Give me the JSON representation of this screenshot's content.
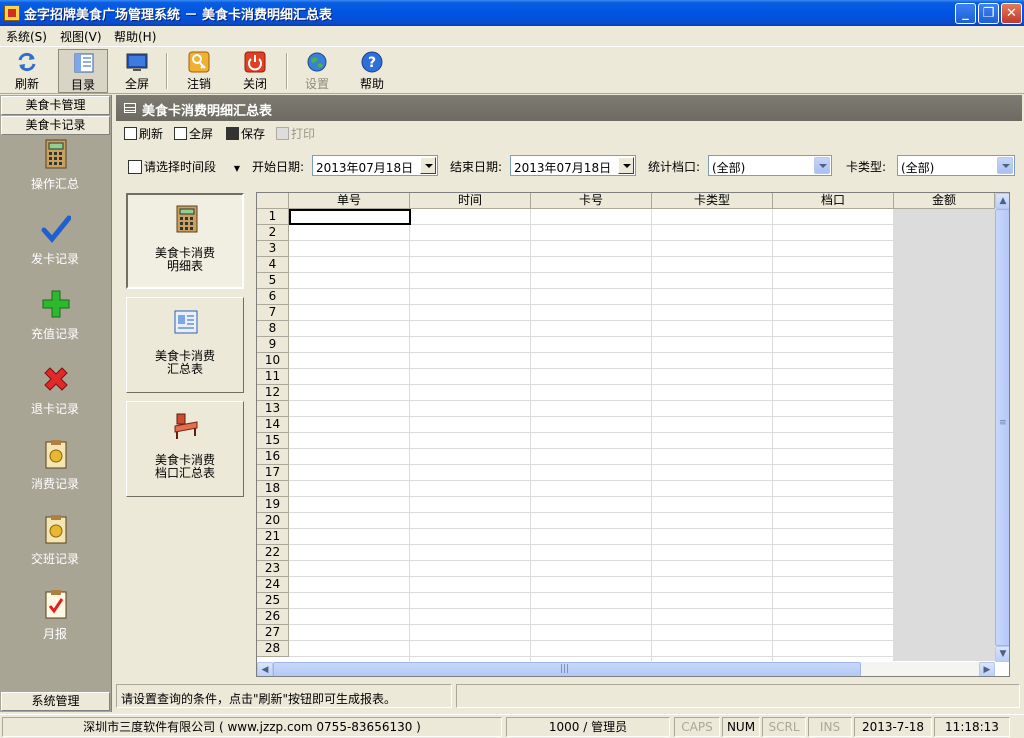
{
  "window": {
    "title": "金字招牌美食广场管理系统 － 美食卡消费明细汇总表",
    "min_glyph": "_",
    "max_glyph": "❐",
    "close_glyph": "✕"
  },
  "menubar": [
    "系统(S)",
    "视图(V)",
    "帮助(H)"
  ],
  "toolbar": {
    "refresh": "刷新",
    "directory": "目录",
    "fullscreen": "全屏",
    "logout": "注销",
    "close": "关闭",
    "settings": "设置",
    "help": "帮助"
  },
  "leftnav": {
    "sections": [
      "美食卡管理",
      "美食卡记录"
    ],
    "items": [
      {
        "label": "操作汇总",
        "icon": "calculator-icon"
      },
      {
        "label": "发卡记录",
        "icon": "checkmark-icon"
      },
      {
        "label": "充值记录",
        "icon": "plus-icon"
      },
      {
        "label": "退卡记录",
        "icon": "x-icon"
      },
      {
        "label": "消费记录",
        "icon": "clipboard-coin-icon"
      },
      {
        "label": "交班记录",
        "icon": "clipboard-coin-icon"
      },
      {
        "label": "月报",
        "icon": "clipboard-check-icon"
      }
    ],
    "footer": "系统管理"
  },
  "panel": {
    "title": "美食卡消费明细汇总表",
    "subtoolbar": {
      "refresh": "刷新",
      "fullscreen": "全屏",
      "save": "保存",
      "print": "打印"
    }
  },
  "filters": {
    "period_label": "请选择时间段",
    "start_label": "开始日期:",
    "start_value": "2013年07月18日",
    "end_label": "结束日期:",
    "end_value": "2013年07月18日",
    "stall_label": "统计档口:",
    "stall_value": "(全部)",
    "cardtype_label": "卡类型:",
    "cardtype_value": "(全部)"
  },
  "reports": [
    {
      "line1": "美食卡消费",
      "line2": "明细表",
      "icon": "calculator-icon"
    },
    {
      "line1": "美食卡消费",
      "line2": "汇总表",
      "icon": "id-card-icon"
    },
    {
      "line1": "美食卡消费",
      "line2": "档口汇总表",
      "icon": "stall-desk-icon"
    }
  ],
  "grid": {
    "columns": [
      "单号",
      "时间",
      "卡号",
      "卡类型",
      "档口",
      "金额"
    ],
    "row_numbers": [
      "1",
      "2",
      "3",
      "4",
      "5",
      "6",
      "7",
      "8",
      "9",
      "10",
      "11",
      "12",
      "13",
      "14",
      "15",
      "16",
      "17",
      "18",
      "19",
      "20",
      "21",
      "22",
      "23",
      "24",
      "25",
      "26",
      "27",
      "28"
    ],
    "hscroll_grip": "|||",
    "vscroll_grip": "≡"
  },
  "hint": "请设置查询的条件，点击\"刷新\"按钮即可生成报表。",
  "statusbar": {
    "company": "深圳市三度软件有限公司 ( www.jzzp.com  0755-83656130 )",
    "user": "1000 / 管理员",
    "caps": "CAPS",
    "num": "NUM",
    "scrl": "SCRL",
    "ins": "INS",
    "date": "2013-7-18",
    "time": "11:18:13"
  },
  "colors": {
    "titlebar": "#0054e3",
    "panel_header": "#6d6b61",
    "leftnav_bg": "#a8a595",
    "window_bg": "#ece9d8"
  }
}
